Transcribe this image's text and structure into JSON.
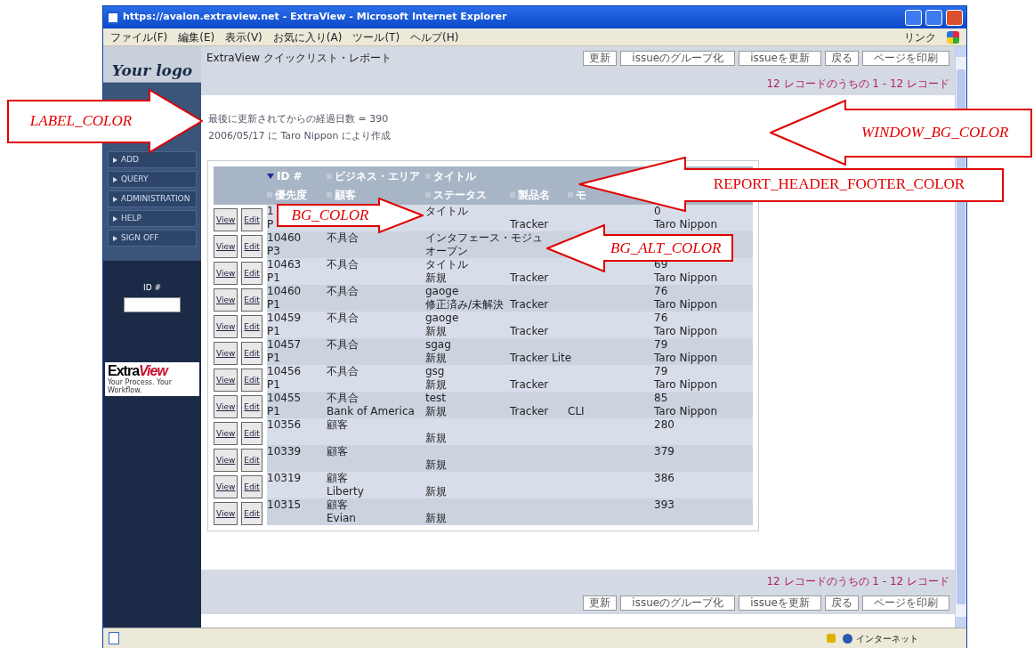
{
  "window": {
    "title": "https://avalon.extraview.net - ExtraView - Microsoft Internet Explorer"
  },
  "menu": [
    "ファイル(F)",
    "編集(E)",
    "表示(V)",
    "お気に入り(A)",
    "ツール(T)",
    "ヘルプ(H)"
  ],
  "links_label": "リンク",
  "logo": {
    "word_1": "Your",
    "word_2": "logo"
  },
  "sidebar": {
    "items": [
      "ADD",
      "QUERY",
      "ADMINISTRATION",
      "HELP",
      "SIGN OFF"
    ],
    "id_label": "ID #",
    "brand": {
      "part_1": "Extra",
      "part_2": "View",
      "tagline": "Your Process. Your Workflow."
    }
  },
  "page_title": "ExtraView クイックリスト・レポート",
  "toolbar_top": [
    "更新",
    "issueのグループ化",
    "issueを更新",
    "戻る",
    "ページを印刷"
  ],
  "record_count_top": "12 レコードのうちの 1 - 12 レコード",
  "info": [
    "最後に更新されてからの経過日数 = 390",
    "2006/05/17 に Taro Nippon により作成"
  ],
  "table": {
    "header_line_1": [
      {
        "label": "ID #",
        "sorted": true
      },
      {
        "label": "ビジネス・エリア",
        "sorted": false
      },
      {
        "label": "タイトル",
        "sorted": false
      }
    ],
    "header_line_2": [
      {
        "label": "優先度",
        "sorted": false
      },
      {
        "label": "顧客",
        "sorted": false
      },
      {
        "label": "ステータス",
        "sorted": false
      },
      {
        "label": "製品名",
        "sorted": false
      },
      {
        "label": "モ",
        "sorted": false
      }
    ],
    "rows": [
      {
        "buttons": [
          "View",
          "Edit"
        ],
        "id": "1",
        "title": "タイトル",
        "days": "0",
        "priority": "P",
        "product": "Tracker",
        "owner": "Taro Nippon"
      },
      {
        "buttons": [
          "View",
          "Edit"
        ],
        "id": "10460",
        "area": "不具合",
        "title": "インタフェース・モジュ",
        "priority": "P3",
        "status": "オープン"
      },
      {
        "buttons": [
          "View",
          "Edit"
        ],
        "id": "10463",
        "area": "不具合",
        "title": "タイトル",
        "days": "69",
        "priority": "P1",
        "status": "新規",
        "product": "Tracker",
        "owner": "Taro Nippon"
      },
      {
        "buttons": [
          "View",
          "Edit"
        ],
        "id": "10460",
        "area": "不具合",
        "title": "gaoge",
        "days": "76",
        "priority": "P1",
        "status": "修正済み/未解決",
        "product": "Tracker",
        "owner": "Taro Nippon"
      },
      {
        "buttons": [
          "View",
          "Edit"
        ],
        "id": "10459",
        "area": "不具合",
        "title": "gaoge",
        "days": "76",
        "priority": "P1",
        "status": "新規",
        "product": "Tracker",
        "owner": "Taro Nippon"
      },
      {
        "buttons": [
          "View",
          "Edit"
        ],
        "id": "10457",
        "area": "不具合",
        "title": "sgag",
        "days": "79",
        "priority": "P1",
        "status": "新規",
        "product": "Tracker Lite",
        "owner": "Taro Nippon"
      },
      {
        "buttons": [
          "View",
          "Edit"
        ],
        "id": "10456",
        "area": "不具合",
        "title": "gsg",
        "days": "79",
        "priority": "P1",
        "status": "新規",
        "product": "Tracker",
        "owner": "Taro Nippon"
      },
      {
        "buttons": [
          "View",
          "Edit"
        ],
        "id": "10455",
        "area": "不具合",
        "title": "test",
        "days": "85",
        "priority": "P1",
        "customer": "Bank of America",
        "status": "新規",
        "product": "Tracker",
        "module": "CLI",
        "owner": "Taro Nippon"
      },
      {
        "buttons": [
          "View",
          "Edit"
        ],
        "id": "10356",
        "area": "顧客",
        "days": "280",
        "status": "新規"
      },
      {
        "buttons": [
          "View",
          "Edit"
        ],
        "id": "10339",
        "area": "顧客",
        "days": "379",
        "status": "新規"
      },
      {
        "buttons": [
          "View",
          "Edit"
        ],
        "id": "10319",
        "area": "顧客",
        "days": "386",
        "customer": "Liberty",
        "status": "新規"
      },
      {
        "buttons": [
          "View",
          "Edit"
        ],
        "id": "10315",
        "area": "顧客",
        "days": "393",
        "customer": "Evian",
        "status": "新規"
      }
    ]
  },
  "record_count_bottom": "12 レコードのうちの 1 - 12 レコード",
  "toolbar_bottom": [
    "更新",
    "issueのグループ化",
    "issueを更新",
    "戻る",
    "ページを印刷"
  ],
  "status_bar": {
    "zone": "インターネット"
  },
  "annotations": [
    {
      "text": "LABEL_COLOR",
      "kind": "rightward",
      "italic": true
    },
    {
      "text": "WINDOW_BG_COLOR",
      "kind": "leftward",
      "italic": true
    },
    {
      "text": "REPORT_HEADER_FOOTER_COLOR",
      "kind": "leftward",
      "italic": false
    },
    {
      "text": "BG_COLOR",
      "kind": "rightward",
      "italic": true
    },
    {
      "text": "BG_ALT_COLOR",
      "kind": "leftward",
      "italic": true
    }
  ]
}
